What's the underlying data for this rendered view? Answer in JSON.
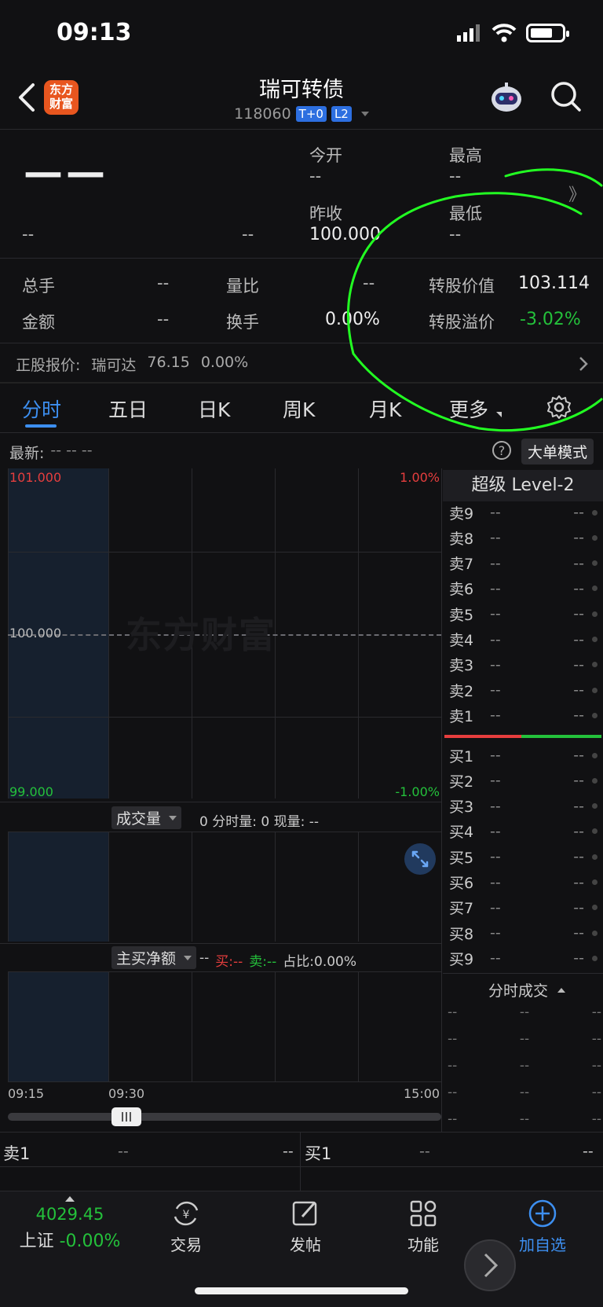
{
  "status": {
    "time": "09:13"
  },
  "header": {
    "logo_text_1": "东方",
    "logo_text_2": "财富",
    "title": "瑞可转债",
    "code": "118060",
    "tag1": "T+0",
    "tag2": "L2"
  },
  "quote": {
    "price": "——",
    "change": "--",
    "change_pct": "--",
    "open_label": "今开",
    "open": "--",
    "high_label": "最高",
    "high": "--",
    "prev_close_label": "昨收",
    "prev_close": "100.000",
    "low_label": "最低",
    "low": "--",
    "more_glyph": "》"
  },
  "stats": {
    "volume_label": "总手",
    "volume": "--",
    "vol_ratio_label": "量比",
    "vol_ratio": "--",
    "conv_value_label": "转股价值",
    "conv_value": "103.114",
    "amount_label": "金额",
    "amount": "--",
    "turnover_label": "换手",
    "turnover": "0.00%",
    "conv_premium_label": "转股溢价",
    "conv_premium": "-3.02%"
  },
  "underlying": {
    "label": "正股报价:",
    "name": "瑞可达",
    "price": "76.15",
    "pct": "0.00%"
  },
  "tabs": [
    "分时",
    "五日",
    "日K",
    "周K",
    "月K",
    "更多"
  ],
  "chart_header": {
    "latest_label": "最新:",
    "latest_vals": "-- -- --",
    "mode_button": "大单模式"
  },
  "chart_axis": {
    "y_top": "101.000",
    "y_mid": "100.000",
    "y_bottom": "99.000",
    "pct_top": "1.00%",
    "pct_bottom": "-1.00%",
    "watermark": "东方财富",
    "time_start": "09:15",
    "time_mid": "09:30",
    "time_end": "15:00"
  },
  "volume_panel": {
    "dropdown": "成交量",
    "text": "0 分时量: 0 现量: --"
  },
  "netbuy_panel": {
    "dropdown": "主买净额",
    "prefix": "--",
    "buy": "买:--",
    "sell": "卖:--",
    "ratio": "占比:0.00%"
  },
  "orderbook": {
    "title": "超级 Level-2",
    "sells": [
      "卖9",
      "卖8",
      "卖7",
      "卖6",
      "卖5",
      "卖4",
      "卖3",
      "卖2",
      "卖1"
    ],
    "buys": [
      "买1",
      "买2",
      "买3",
      "买4",
      "买5",
      "买6",
      "买7",
      "买8",
      "买9"
    ],
    "empty": "--"
  },
  "trades": {
    "title": "分时成交",
    "rows": 5,
    "empty": "--"
  },
  "bottom_strip": {
    "sell_label": "卖1",
    "sell_price": "--",
    "sell_vol": "--",
    "buy_label": "买1",
    "buy_price": "--",
    "buy_vol": "--"
  },
  "nav": {
    "index_value": "4029.45",
    "index_name": "上证",
    "index_pct": "-0.00%",
    "trade": "交易",
    "post": "发帖",
    "functions": "功能",
    "add_watch": "加自选"
  },
  "colors": {
    "accent": "#3d8ff0",
    "up": "#e63e3e",
    "down": "#24c13b",
    "annotation": "#22ff22"
  }
}
